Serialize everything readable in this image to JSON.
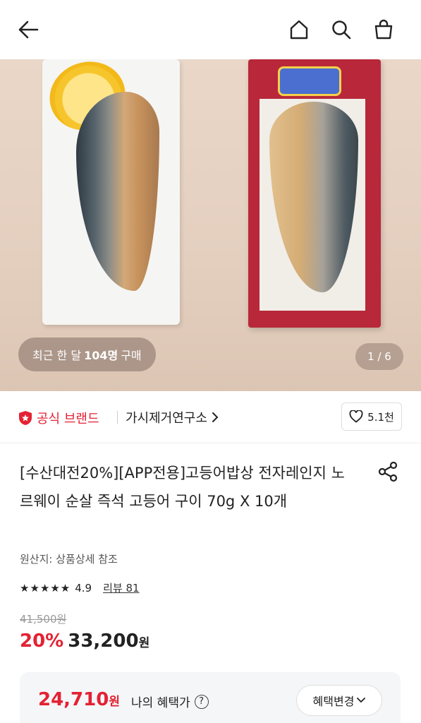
{
  "header": {
    "icons": [
      "back-arrow-icon",
      "home-icon",
      "search-icon",
      "shopping-bag-icon"
    ]
  },
  "hero": {
    "recent_prefix": "최근 한 달",
    "recent_count": "104명",
    "recent_suffix": "구매",
    "pager": "1 / 6"
  },
  "brand": {
    "official_label": "공식 브랜드",
    "shop_name": "가시제거연구소",
    "like_count": "5.1천"
  },
  "product": {
    "title": "[수산대전20%][APP전용]고등어밥상 전자레인지 노르웨이 순살 즉석 고등어 구이 70g X 10개",
    "origin": "원산지: 상품상세 참조",
    "stars": "★★★★★",
    "rating": "4.9",
    "review": "리뷰 81",
    "original_price": "41,500원",
    "discount": "20%",
    "price": "33,200",
    "price_unit": "원"
  },
  "benefit": {
    "price": "24,710",
    "unit": "원",
    "label": "나의 혜택가",
    "help": "?",
    "change_label": "혜택변경"
  },
  "colors": {
    "accent_red": "#e32233",
    "benefit_bg": "#f5f6f8"
  }
}
